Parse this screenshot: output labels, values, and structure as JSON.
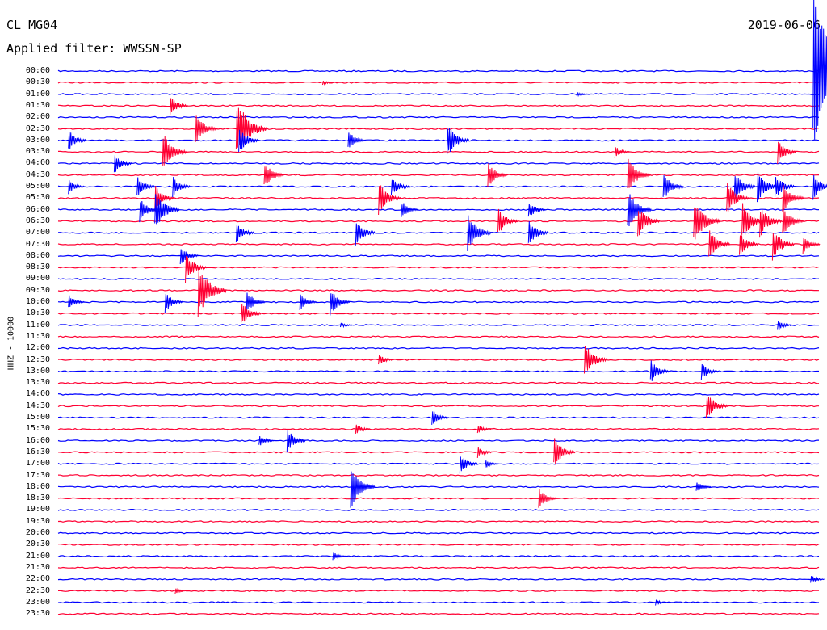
{
  "header": {
    "station": "CL MG04",
    "filter": "Applied filter: WWSSN-SP",
    "date": "2019-06-06"
  },
  "colors": {
    "odd": "#0000ff",
    "even": "#ff0033"
  },
  "chart_data": {
    "type": "line",
    "title": "CL MG04",
    "subtitle": "Applied filter: WWSSN-SP",
    "ylabel": "HHZ - 10000",
    "xlim": [
      0,
      30
    ],
    "tick_labels": [
      "00:00",
      "00:30",
      "01:00",
      "01:30",
      "02:00",
      "02:30",
      "03:00",
      "03:30",
      "04:00",
      "04:30",
      "05:00",
      "05:30",
      "06:00",
      "06:30",
      "07:00",
      "07:30",
      "08:00",
      "08:30",
      "09:00",
      "09:30",
      "10:00",
      "10:30",
      "11:00",
      "11:30",
      "12:00",
      "12:30",
      "13:00",
      "13:30",
      "14:00",
      "14:30",
      "15:00",
      "15:30",
      "16:00",
      "16:30",
      "17:00",
      "17:30",
      "18:00",
      "18:30",
      "19:00",
      "19:30",
      "20:00",
      "20:30",
      "21:00",
      "21:30",
      "22:00",
      "22:30",
      "23:00",
      "23:30"
    ],
    "events": [
      {
        "row": 0,
        "t": 29.8,
        "amp": 95
      },
      {
        "row": 1,
        "t": 10.5,
        "amp": 3
      },
      {
        "row": 2,
        "t": 20.5,
        "amp": 3
      },
      {
        "row": 3,
        "t": 4.5,
        "amp": 14
      },
      {
        "row": 5,
        "t": 5.5,
        "amp": 20
      },
      {
        "row": 5,
        "t": 7.1,
        "amp": 40
      },
      {
        "row": 6,
        "t": 0.5,
        "amp": 14
      },
      {
        "row": 6,
        "t": 7.2,
        "amp": 18
      },
      {
        "row": 6,
        "t": 11.5,
        "amp": 13
      },
      {
        "row": 6,
        "t": 15.4,
        "amp": 22
      },
      {
        "row": 7,
        "t": 4.2,
        "amp": 26
      },
      {
        "row": 7,
        "t": 22.0,
        "amp": 8
      },
      {
        "row": 7,
        "t": 28.4,
        "amp": 16
      },
      {
        "row": 8,
        "t": 2.3,
        "amp": 14
      },
      {
        "row": 9,
        "t": 8.2,
        "amp": 18
      },
      {
        "row": 9,
        "t": 17.0,
        "amp": 17
      },
      {
        "row": 9,
        "t": 22.5,
        "amp": 24
      },
      {
        "row": 10,
        "t": 0.5,
        "amp": 10
      },
      {
        "row": 10,
        "t": 3.2,
        "amp": 15
      },
      {
        "row": 10,
        "t": 4.6,
        "amp": 14
      },
      {
        "row": 10,
        "t": 13.2,
        "amp": 15
      },
      {
        "row": 10,
        "t": 23.9,
        "amp": 19
      },
      {
        "row": 10,
        "t": 29.8,
        "amp": 18
      },
      {
        "row": 10,
        "t": 26.7,
        "amp": 20
      },
      {
        "row": 10,
        "t": 27.6,
        "amp": 22
      },
      {
        "row": 10,
        "t": 28.3,
        "amp": 18
      },
      {
        "row": 11,
        "t": 3.9,
        "amp": 17
      },
      {
        "row": 11,
        "t": 12.7,
        "amp": 22
      },
      {
        "row": 11,
        "t": 26.4,
        "amp": 22
      },
      {
        "row": 11,
        "t": 28.6,
        "amp": 20
      },
      {
        "row": 12,
        "t": 3.3,
        "amp": 16
      },
      {
        "row": 12,
        "t": 3.9,
        "amp": 28
      },
      {
        "row": 12,
        "t": 13.6,
        "amp": 12
      },
      {
        "row": 12,
        "t": 18.6,
        "amp": 12
      },
      {
        "row": 12,
        "t": 22.5,
        "amp": 26
      },
      {
        "row": 13,
        "t": 17.4,
        "amp": 18
      },
      {
        "row": 13,
        "t": 22.9,
        "amp": 22
      },
      {
        "row": 13,
        "t": 25.1,
        "amp": 30
      },
      {
        "row": 13,
        "t": 27.0,
        "amp": 26
      },
      {
        "row": 13,
        "t": 27.7,
        "amp": 22
      },
      {
        "row": 13,
        "t": 28.6,
        "amp": 20
      },
      {
        "row": 14,
        "t": 7.1,
        "amp": 14
      },
      {
        "row": 14,
        "t": 11.8,
        "amp": 18
      },
      {
        "row": 14,
        "t": 16.2,
        "amp": 26
      },
      {
        "row": 14,
        "t": 18.6,
        "amp": 18
      },
      {
        "row": 15,
        "t": 25.7,
        "amp": 20
      },
      {
        "row": 15,
        "t": 26.9,
        "amp": 16
      },
      {
        "row": 15,
        "t": 28.2,
        "amp": 22
      },
      {
        "row": 15,
        "t": 29.4,
        "amp": 12
      },
      {
        "row": 16,
        "t": 4.9,
        "amp": 14
      },
      {
        "row": 17,
        "t": 5.1,
        "amp": 20
      },
      {
        "row": 19,
        "t": 5.6,
        "amp": 35
      },
      {
        "row": 20,
        "t": 0.5,
        "amp": 10
      },
      {
        "row": 20,
        "t": 4.3,
        "amp": 14
      },
      {
        "row": 20,
        "t": 7.5,
        "amp": 16
      },
      {
        "row": 20,
        "t": 9.6,
        "amp": 12
      },
      {
        "row": 20,
        "t": 10.8,
        "amp": 18
      },
      {
        "row": 21,
        "t": 7.3,
        "amp": 18
      },
      {
        "row": 22,
        "t": 11.2,
        "amp": 4
      },
      {
        "row": 22,
        "t": 28.4,
        "amp": 8
      },
      {
        "row": 25,
        "t": 12.7,
        "amp": 8
      },
      {
        "row": 25,
        "t": 20.8,
        "amp": 24
      },
      {
        "row": 26,
        "t": 23.4,
        "amp": 16
      },
      {
        "row": 26,
        "t": 25.4,
        "amp": 12
      },
      {
        "row": 29,
        "t": 25.6,
        "amp": 20
      },
      {
        "row": 30,
        "t": 14.8,
        "amp": 12
      },
      {
        "row": 31,
        "t": 11.8,
        "amp": 8
      },
      {
        "row": 31,
        "t": 16.6,
        "amp": 6
      },
      {
        "row": 32,
        "t": 9.1,
        "amp": 16
      },
      {
        "row": 32,
        "t": 8.0,
        "amp": 8
      },
      {
        "row": 33,
        "t": 16.6,
        "amp": 8
      },
      {
        "row": 33,
        "t": 19.6,
        "amp": 20
      },
      {
        "row": 34,
        "t": 15.9,
        "amp": 14
      },
      {
        "row": 34,
        "t": 16.9,
        "amp": 6
      },
      {
        "row": 36,
        "t": 11.6,
        "amp": 28
      },
      {
        "row": 36,
        "t": 25.2,
        "amp": 8
      },
      {
        "row": 37,
        "t": 19.0,
        "amp": 14
      },
      {
        "row": 42,
        "t": 10.9,
        "amp": 6
      },
      {
        "row": 44,
        "t": 29.7,
        "amp": 6
      },
      {
        "row": 45,
        "t": 4.7,
        "amp": 4
      },
      {
        "row": 46,
        "t": 23.6,
        "amp": 4
      }
    ],
    "grid": false
  }
}
